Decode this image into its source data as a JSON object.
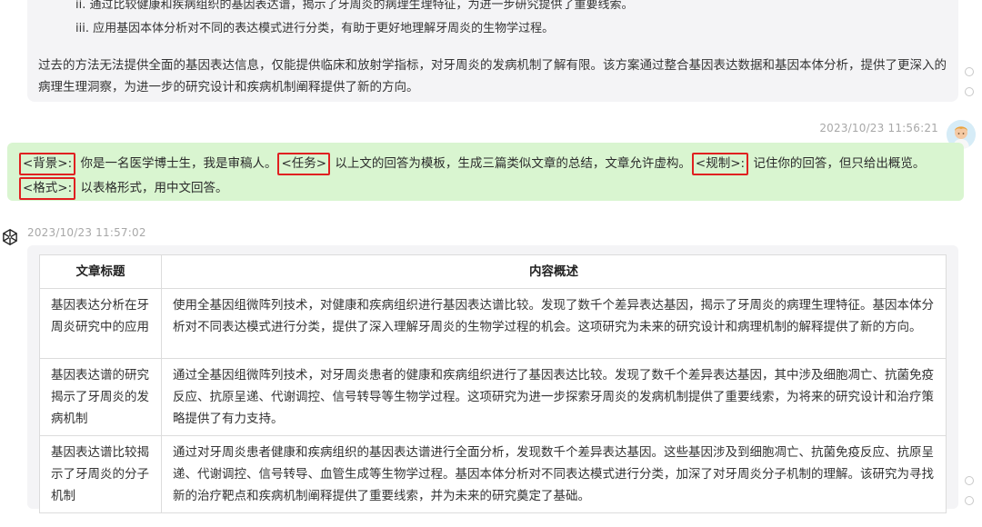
{
  "previous_message": {
    "list_items": [
      "ii. 通过比较健康和疾病组织的基因表达谱，揭示了牙周炎的病理生理特征，为进一步研究提供了重要线索。",
      "iii. 应用基因本体分析对不同的表达模式进行分类，有助于更好地理解牙周炎的生物学过程。"
    ],
    "paragraph": "过去的方法无法提供全面的基因表达信息，仅能提供临床和放射学指标，对牙周炎的发病机制了解有限。该方案通过整合基因表达数据和基因本体分析，提供了更深入的病理生理洞察，为进一步的研究设计和疾病机制阐释提供了新的方向。"
  },
  "user_message": {
    "timestamp": "2023/10/23 11:56:21",
    "segments": {
      "tag_background": "<背景>:",
      "text_background": " 你是一名医学博士生，我是审稿人。",
      "tag_task": "<任务>",
      "text_task": " 以上文的回答为模板，生成三篇类似文章的总结，文章允许虚构。",
      "tag_rule": "<规制>:",
      "text_rule": " 记住你的回答，但只给出概览。",
      "tag_format": "<格式>:",
      "text_format": " 以表格形式，用中文回答。"
    }
  },
  "ai_message": {
    "timestamp": "2023/10/23 11:57:02",
    "table": {
      "headers": [
        "文章标题",
        "内容概述"
      ],
      "rows": [
        {
          "title": "基因表达分析在牙周炎研究中的应用",
          "summary": "使用全基因组微阵列技术，对健康和疾病组织进行基因表达谱比较。发现了数千个差异表达基因，揭示了牙周炎的病理生理特征。基因本体分析对不同表达模式进行分类，提供了深入理解牙周炎的生物学过程的机会。这项研究为未来的研究设计和病理机制的解释提供了新的方向。"
        },
        {
          "title": "基因表达谱的研究揭示了牙周炎的发病机制",
          "summary": "通过全基因组微阵列技术，对牙周炎患者的健康和疾病组织进行了基因表达比较。发现了数千个差异表达基因，其中涉及细胞凋亡、抗菌免疫反应、抗原呈递、代谢调控、信号转导等生物学过程。这项研究为进一步探索牙周炎的发病机制提供了重要线索，为将来的研究设计和治疗策略提供了有力支持。"
        },
        {
          "title": "基因表达谱比较揭示了牙周炎的分子机制",
          "summary": "通过对牙周炎患者健康和疾病组织的基因表达谱进行全面分析，发现数千个差异表达基因。这些基因涉及到细胞凋亡、抗菌免疫反应、抗原呈递、代谢调控、信号转导、血管生成等生物学过程。基因本体分析对不同表达模式进行分类，加深了对牙周炎分子机制的理解。该研究为寻找新的治疗靶点和疾病机制阐释提供了重要线索，并为未来的研究奠定了基础。"
        }
      ]
    }
  },
  "icons": {
    "ai": "openai-logo-icon",
    "user": "user-avatar-icon"
  },
  "colors": {
    "user_bubble": "#d9f5d0",
    "ai_bubble": "#f4f4f6",
    "tag_outline": "#e02020",
    "timestamp": "#a8a8a8"
  }
}
